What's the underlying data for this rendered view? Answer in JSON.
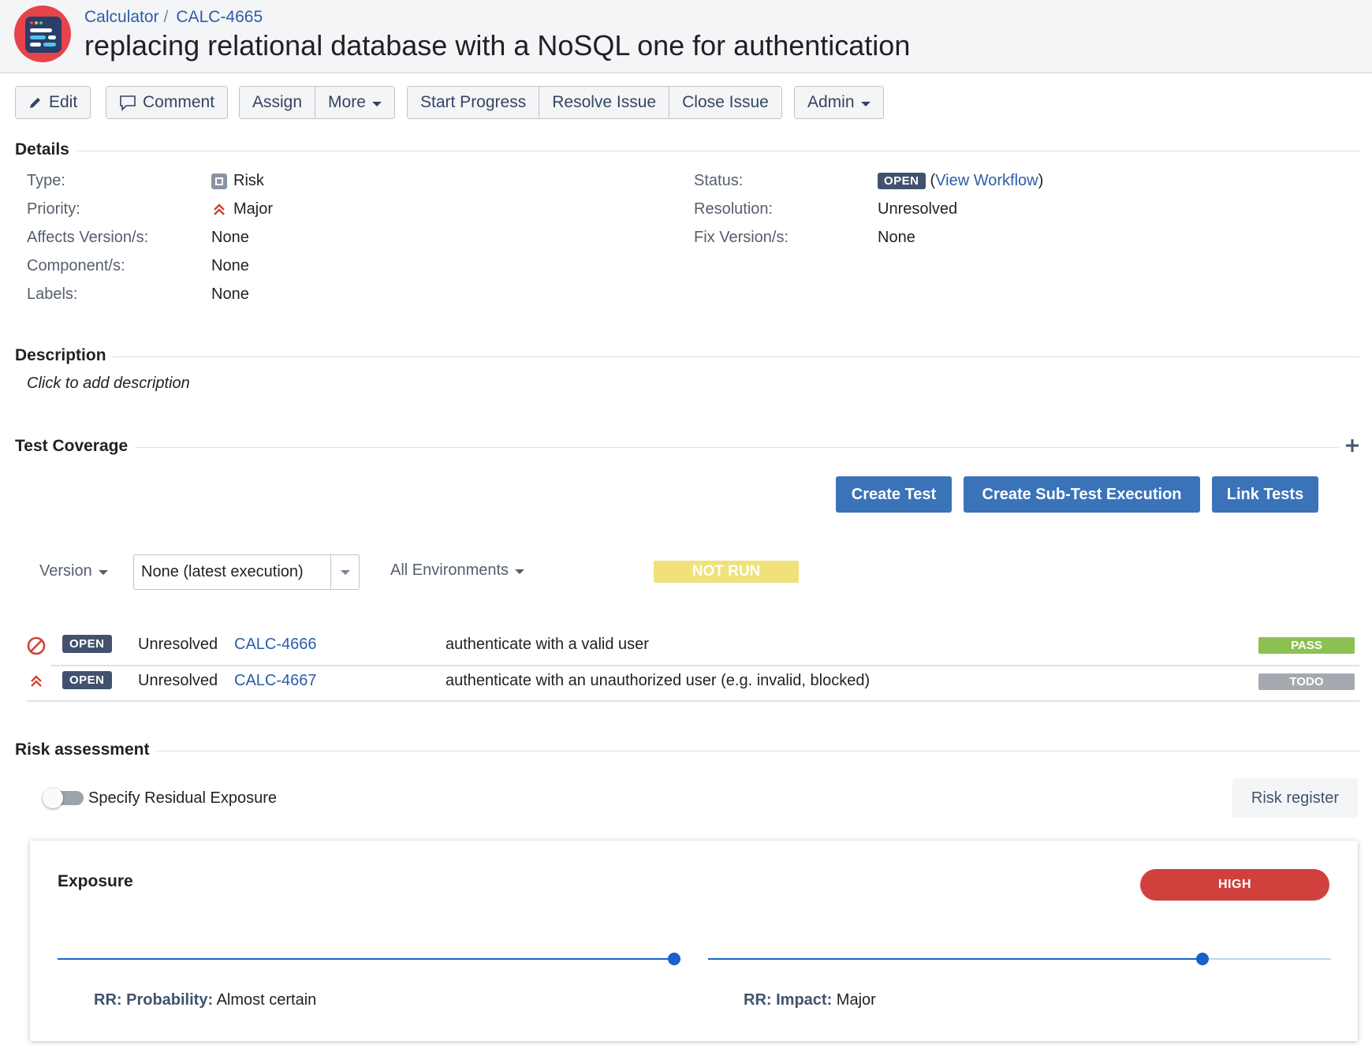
{
  "header": {
    "breadcrumb_project": "Calculator",
    "breadcrumb_sep": "/",
    "breadcrumb_issue": "CALC-4665",
    "title": "replacing relational database with a NoSQL one for authentication"
  },
  "toolbar": {
    "edit": "Edit",
    "comment": "Comment",
    "assign": "Assign",
    "more": "More",
    "start_progress": "Start Progress",
    "resolve_issue": "Resolve Issue",
    "close_issue": "Close Issue",
    "admin": "Admin"
  },
  "details": {
    "title": "Details",
    "type_label": "Type:",
    "type_value": "Risk",
    "priority_label": "Priority:",
    "priority_value": "Major",
    "affects_label": "Affects Version/s:",
    "affects_value": "None",
    "components_label": "Component/s:",
    "components_value": "None",
    "labels_label": "Labels:",
    "labels_value": "None",
    "status_label": "Status:",
    "status_value": "OPEN",
    "view_workflow_open": "(",
    "view_workflow": "View Workflow",
    "view_workflow_close": ")",
    "resolution_label": "Resolution:",
    "resolution_value": "Unresolved",
    "fix_label": "Fix Version/s:",
    "fix_value": "None"
  },
  "description": {
    "title": "Description",
    "placeholder": "Click to add description"
  },
  "test_coverage": {
    "title": "Test Coverage",
    "create_test": "Create Test",
    "create_sub_test_execution": "Create Sub-Test Execution",
    "link_tests": "Link Tests",
    "version_label": "Version",
    "version_select_value": "None (latest execution)",
    "environments_label": "All Environments",
    "overall_status": "NOT RUN",
    "colors": {
      "not_run": "#f1e17a",
      "pass": "#8cc152",
      "todo": "#a5a9b0"
    },
    "rows": [
      {
        "status": "OPEN",
        "resolution": "Unresolved",
        "key": "CALC-4666",
        "summary": "authenticate with a valid user",
        "result": "PASS",
        "icon": "blocker-icon"
      },
      {
        "status": "OPEN",
        "resolution": "Unresolved",
        "key": "CALC-4667",
        "summary": "authenticate with an unauthorized user (e.g. invalid, blocked)",
        "result": "TODO",
        "icon": "major-priority-icon"
      }
    ]
  },
  "risk_assessment": {
    "title": "Risk assessment",
    "toggle_label": "Specify Residual Exposure",
    "toggle_on": false,
    "risk_register": "Risk register",
    "exposure_title": "Exposure",
    "exposure_level": "HIGH",
    "exposure_color": "#d0413e",
    "probability_label": "RR: Probability:",
    "probability_value": "Almost certain",
    "probability_level": 1.0,
    "impact_label": "RR: Impact:",
    "impact_value": "Major",
    "impact_level": 0.8
  }
}
